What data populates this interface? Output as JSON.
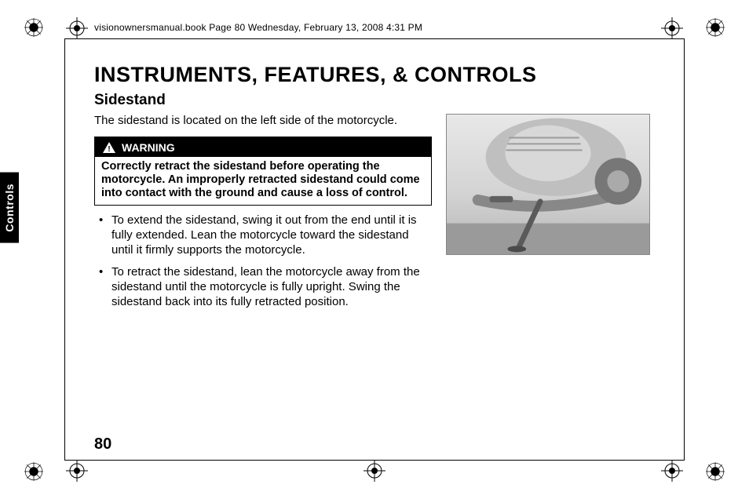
{
  "header": "visionownersmanual.book  Page 80  Wednesday, February 13, 2008  4:31 PM",
  "title": "INSTRUMENTS, FEATURES, & CONTROLS",
  "subtitle": "Sidestand",
  "intro": "The sidestand is located on the left side of the motorcycle.",
  "warning": {
    "label": "WARNING",
    "body": "Correctly retract the sidestand before operating the motorcycle. An improperly retracted sidestand could come into contact with the ground and cause a loss of control."
  },
  "bullets": [
    "To extend the sidestand, swing it out from the end until it is fully extended. Lean the motorcycle toward the sidestand until it firmly supports the motorcycle.",
    "To retract the sidestand, lean the motorcycle away from the sidestand until the motorcycle is fully upright. Swing the sidestand back into its fully retracted position."
  ],
  "side_tab": "Controls",
  "page_number": "80",
  "image_alt": "Motorcycle sidestand"
}
